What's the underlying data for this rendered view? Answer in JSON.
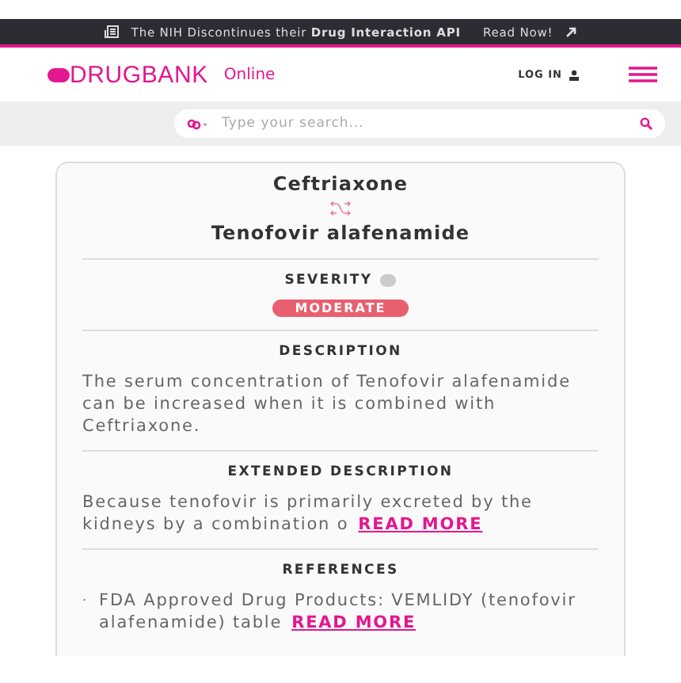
{
  "banner": {
    "text": "The NIH Discontinues their **Drug Interaction API**",
    "link": "Read Now!"
  },
  "header": {
    "brand": "DRUGBANK",
    "brand_suffix": "Online",
    "login": "LOG IN"
  },
  "search": {
    "placeholder": "Type your search..."
  },
  "interaction": {
    "drug_a": "Ceftriaxone",
    "drug_b": "Tenofovir alafenamide"
  },
  "severity": {
    "heading": "SEVERITY",
    "label": "MODERATE",
    "color": "#e8606f"
  },
  "sections": [
    {
      "heading": "DESCRIPTION",
      "text": "The serum concentration of Tenofovir alafenamide can be increased when it is combined with Ceftriaxone."
    },
    {
      "heading": "EXTENDED DESCRIPTION",
      "text": "Because tenofovir is primarily excreted by the kidneys by a combination o",
      "more": "READ MORE"
    },
    {
      "heading": "REFERENCES",
      "text": "FDA Approved Drug Products: VEMLIDY (tenofovir alafenamide) table",
      "more": "READ MORE",
      "bullet": "."
    }
  ]
}
